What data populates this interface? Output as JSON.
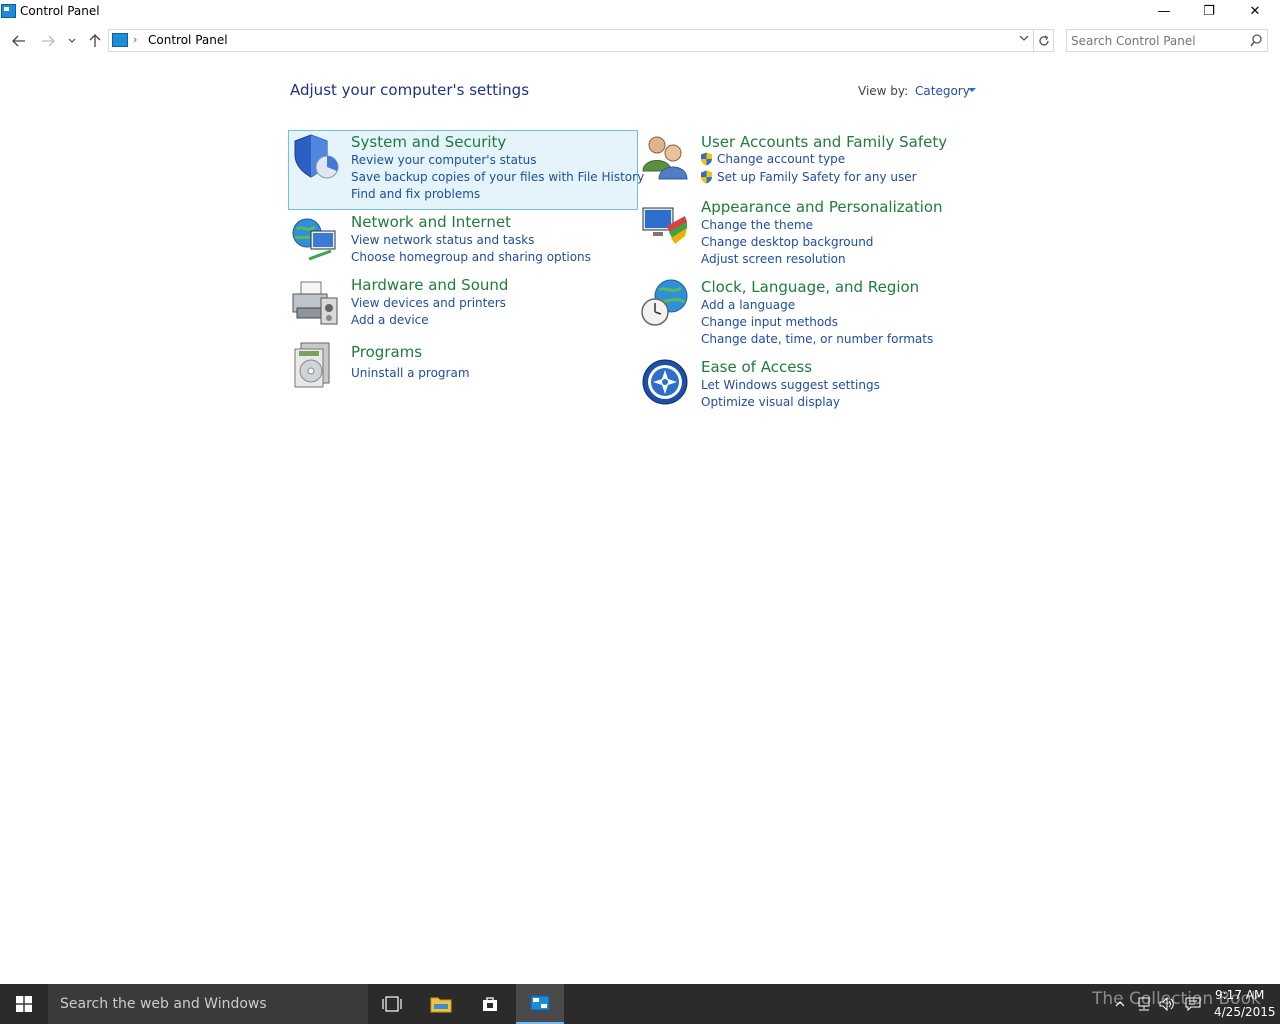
{
  "window": {
    "title": "Control Panel",
    "controls": {
      "minimize": "—",
      "restore": "❐",
      "close": "✕"
    }
  },
  "address": {
    "breadcrumb": "Control Panel",
    "separator": "›",
    "search_placeholder": "Search Control Panel"
  },
  "main": {
    "heading": "Adjust your computer's settings",
    "view_by_label": "View by:",
    "view_by_value": "Category"
  },
  "categories": {
    "system": {
      "title": "System and Security",
      "links": [
        "Review your computer's status",
        "Save backup copies of your files with File History",
        "Find and fix problems"
      ]
    },
    "network": {
      "title": "Network and Internet",
      "links": [
        "View network status and tasks",
        "Choose homegroup and sharing options"
      ]
    },
    "hardware": {
      "title": "Hardware and Sound",
      "links": [
        "View devices and printers",
        "Add a device"
      ]
    },
    "programs": {
      "title": "Programs",
      "links": [
        "Uninstall a program"
      ]
    },
    "users": {
      "title": "User Accounts and Family Safety",
      "links": [
        "Change account type",
        "Set up Family Safety for any user"
      ]
    },
    "appearance": {
      "title": "Appearance and Personalization",
      "links": [
        "Change the theme",
        "Change desktop background",
        "Adjust screen resolution"
      ]
    },
    "clock": {
      "title": "Clock, Language, and Region",
      "links": [
        "Add a language",
        "Change input methods",
        "Change date, time, or number formats"
      ]
    },
    "ease": {
      "title": "Ease of Access",
      "links": [
        "Let Windows suggest settings",
        "Optimize visual display"
      ]
    }
  },
  "taskbar": {
    "search_text": "Search the web and Windows",
    "time": "9:17 AM",
    "date": "4/25/2015",
    "watermark": "The Collection Book"
  },
  "colors": {
    "category_title": "#1e7c3c",
    "link": "#1f4ea3",
    "heading": "#1e3287",
    "selection_bg": "#e5f3fb",
    "selection_border": "#70c0e7",
    "taskbar": "#2b2b2b"
  }
}
